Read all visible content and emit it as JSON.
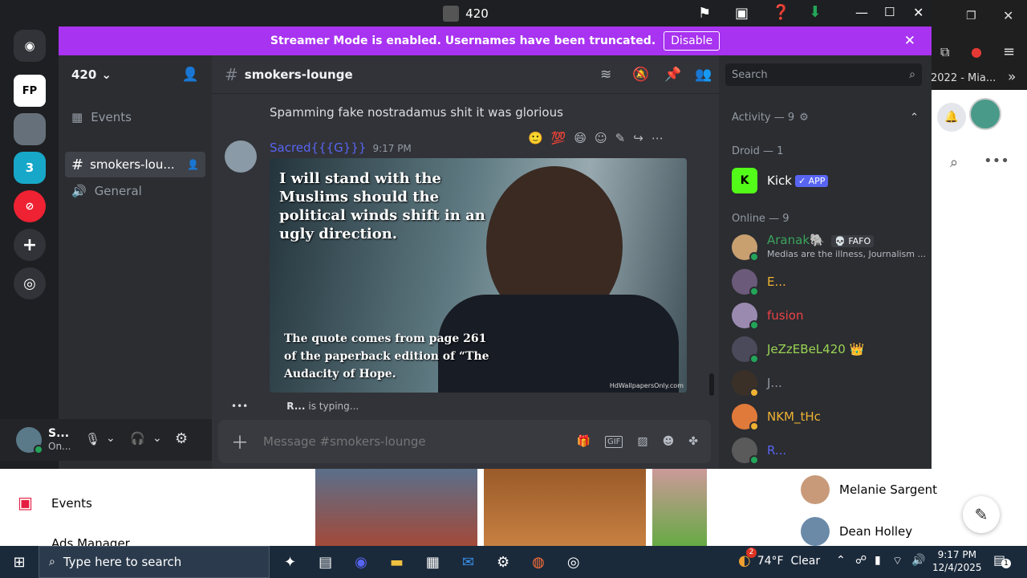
{
  "window": {
    "title": "420"
  },
  "banner": {
    "text": "Streamer Mode is enabled. Usernames have been truncated.",
    "button": "Disable"
  },
  "server": {
    "name": "420",
    "channels": [
      {
        "label": "Events"
      },
      {
        "label": "smokers-lou..."
      },
      {
        "label": "General"
      }
    ]
  },
  "chat": {
    "channel": "smokers-lounge",
    "search_placeholder": "Search",
    "prev_line": "Spamming fake nostradamus shit it was glorious",
    "author": "Sacred{{{G}}}",
    "time": "9:17 PM",
    "meme_top": "I will stand with the Muslims should the political winds shift in an ugly direction.",
    "meme_bottom": "The quote comes from page 261 of the paperback edition of “The Audacity of Hope.",
    "watermark": "HdWallpapersOnly.com",
    "typing_user": "R...",
    "typing_text": "is typing...",
    "input_placeholder": "Message #smokers-lounge"
  },
  "user_panel": {
    "name": "S...",
    "status": "On..."
  },
  "members": {
    "activity": "Activity — 9",
    "droid": "Droid — 1",
    "bot_name": "Kick",
    "bot_badge": "✓ APP",
    "online": "Online — 9",
    "list": [
      {
        "name": "Aranak🐘",
        "badge": "💀 FAFO",
        "sub": "Medias are the illness, Journalism ...",
        "color": "#3ba55c"
      },
      {
        "name": "E...",
        "color": "#f0b232"
      },
      {
        "name": "fusion",
        "color": "#ed4245"
      },
      {
        "name": "JeZzEBeL420 👑",
        "color": "#9bd454"
      },
      {
        "name": "J...",
        "color": "#949ba4"
      },
      {
        "name": "NKM_tHc",
        "color": "#f0b232"
      },
      {
        "name": "R...",
        "color": "#5865f2"
      }
    ]
  },
  "background": {
    "browser_tab": "2022 - Mia...",
    "left_item": "Events",
    "left_item2": "Ads Manager",
    "contacts": [
      {
        "name": "Melanie Sargent"
      },
      {
        "name": "Dean Holley"
      }
    ]
  },
  "taskbar": {
    "search_placeholder": "Type here to search",
    "weather": "74°F  Clear",
    "time": "9:17 PM",
    "date": "12/4/2025",
    "weather_badge": "2",
    "notif_badge": "1"
  },
  "colors": {
    "accent": "#5865f2",
    "banner": "#a833f0"
  }
}
